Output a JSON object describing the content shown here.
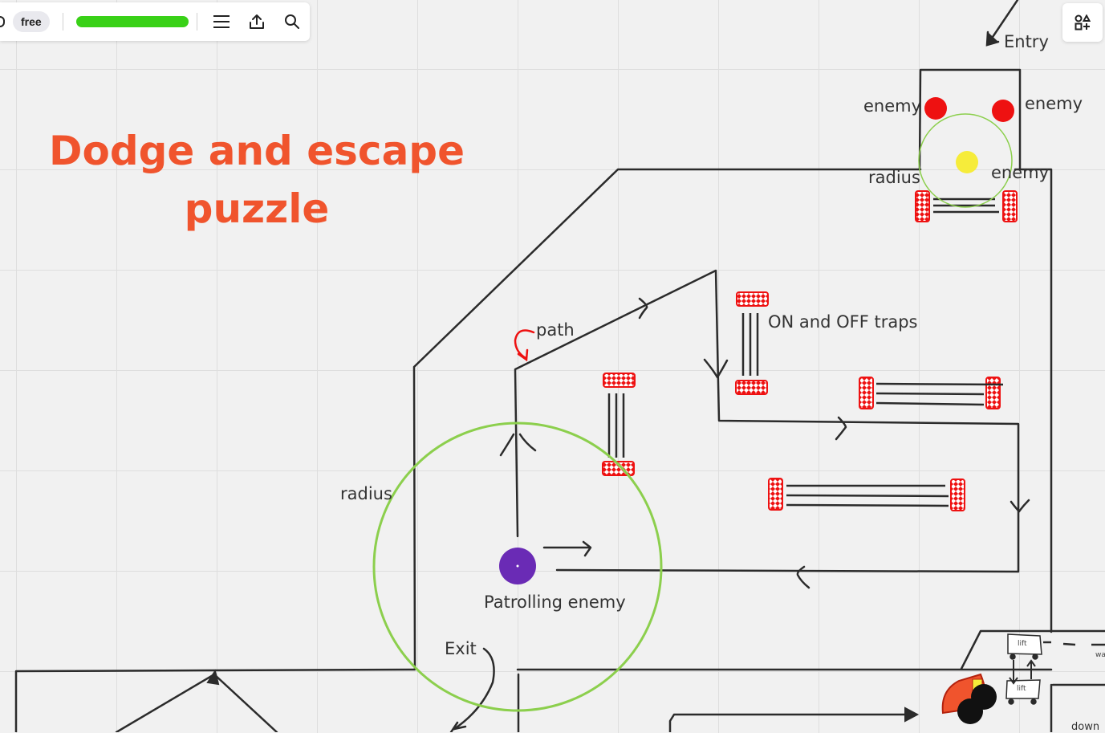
{
  "toolbar": {
    "plan_badge": "free",
    "board_name": "",
    "menu_icon": "hamburger-menu-icon",
    "share_icon": "upload-share-icon",
    "search_icon": "search-icon"
  },
  "shapes_button_icon": "shapes-panel-icon",
  "title_line1": "Dodge and escape",
  "title_line2": "puzzle",
  "labels": {
    "entry": "Entry",
    "enemy_left": "enemy",
    "enemy_right": "enemy",
    "enemy_mid": "enemy",
    "radius_top": "radius",
    "path": "path",
    "on_off_traps": "ON and OFF traps",
    "radius_left": "radius",
    "patrolling_enemy": "Patrolling enemy",
    "exit": "Exit",
    "lift_top": "lift",
    "lift_bottom": "lift",
    "down": "down",
    "wall_partial": "wa"
  },
  "colors": {
    "title": "#f0542d",
    "enemy": "#ee1111",
    "player": "#f6ec3a",
    "patrol_enemy": "#6a2bb5",
    "radius": "#8ccf4d",
    "trap": "#ee1111",
    "lines": "#2b2b2b"
  }
}
